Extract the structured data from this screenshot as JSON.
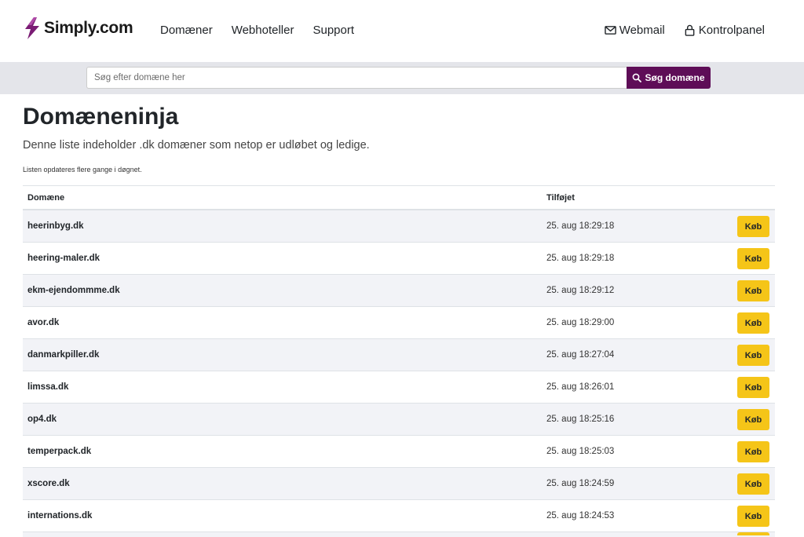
{
  "brand": {
    "name": "Simply.com",
    "accent": "#5e0d57",
    "buy_color": "#f5c518"
  },
  "nav": {
    "links": [
      "Domæner",
      "Webhoteller",
      "Support"
    ],
    "webmail": "Webmail",
    "control_panel": "Kontrolpanel"
  },
  "search": {
    "placeholder": "Søg efter domæne her",
    "button_label": "Søg domæne"
  },
  "page": {
    "title": "Domæneninja",
    "lead": "Denne liste indeholder .dk domæner som netop er udløbet og ledige.",
    "note": "Listen opdateres flere gange i døgnet."
  },
  "table": {
    "headers": {
      "domain": "Domæne",
      "added": "Tilføjet"
    },
    "buy_label": "Køb",
    "rows": [
      {
        "domain": "heerinbyg.dk",
        "added": "25. aug 18:29:18"
      },
      {
        "domain": "heering-maler.dk",
        "added": "25. aug 18:29:18"
      },
      {
        "domain": "ekm-ejendommme.dk",
        "added": "25. aug 18:29:12"
      },
      {
        "domain": "avor.dk",
        "added": "25. aug 18:29:00"
      },
      {
        "domain": "danmarkpiller.dk",
        "added": "25. aug 18:27:04"
      },
      {
        "domain": "limssa.dk",
        "added": "25. aug 18:26:01"
      },
      {
        "domain": "op4.dk",
        "added": "25. aug 18:25:16"
      },
      {
        "domain": "temperpack.dk",
        "added": "25. aug 18:25:03"
      },
      {
        "domain": "xscore.dk",
        "added": "25. aug 18:24:59"
      },
      {
        "domain": "internations.dk",
        "added": "25. aug 18:24:53"
      }
    ]
  }
}
